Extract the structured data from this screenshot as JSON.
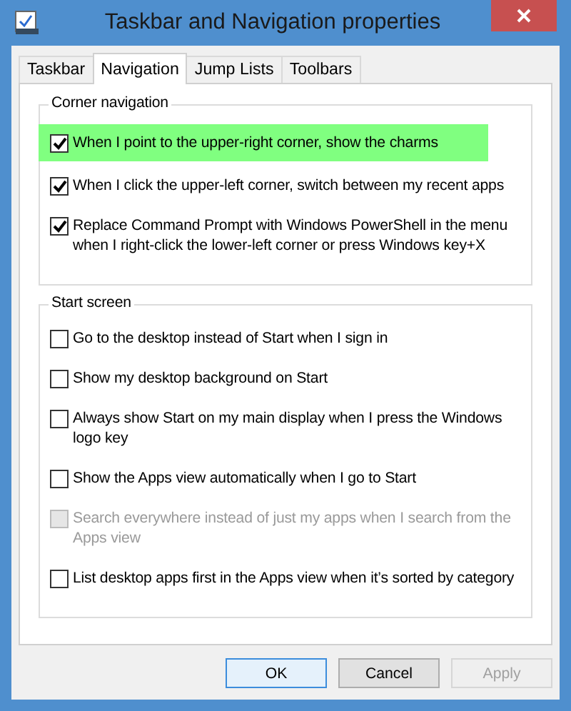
{
  "window": {
    "title": "Taskbar and Navigation properties"
  },
  "tabs": [
    {
      "label": "Taskbar",
      "selected": false
    },
    {
      "label": "Navigation",
      "selected": true
    },
    {
      "label": "Jump Lists",
      "selected": false
    },
    {
      "label": "Toolbars",
      "selected": false
    }
  ],
  "groups": [
    {
      "title": "Corner navigation",
      "options": [
        {
          "label": "When I point to the upper-right corner, show the charms",
          "checked": true,
          "disabled": false,
          "highlighted": true
        },
        {
          "label": "When I click the upper-left corner, switch between my recent apps",
          "checked": true,
          "disabled": false,
          "highlighted": false
        },
        {
          "label": "Replace Command Prompt with Windows PowerShell in the menu when I right-click the lower-left corner or press Windows key+X",
          "checked": true,
          "disabled": false,
          "highlighted": false
        }
      ]
    },
    {
      "title": "Start screen",
      "options": [
        {
          "label": "Go to the desktop instead of Start when I sign in",
          "checked": false,
          "disabled": false,
          "highlighted": false
        },
        {
          "label": "Show my desktop background on Start",
          "checked": false,
          "disabled": false,
          "highlighted": false
        },
        {
          "label": "Always show Start on my main display when I press the Windows logo key",
          "checked": false,
          "disabled": false,
          "highlighted": false
        },
        {
          "label": "Show the Apps view automatically when I go to Start",
          "checked": false,
          "disabled": false,
          "highlighted": false
        },
        {
          "label": "Search everywhere instead of just my apps when I search from the Apps view",
          "checked": false,
          "disabled": true,
          "highlighted": false
        },
        {
          "label": "List desktop apps first in the Apps view when it’s sorted by category",
          "checked": false,
          "disabled": false,
          "highlighted": false
        }
      ]
    }
  ],
  "buttons": [
    {
      "label": "OK",
      "kind": "default",
      "disabled": false
    },
    {
      "label": "Cancel",
      "kind": "normal",
      "disabled": false
    },
    {
      "label": "Apply",
      "kind": "normal",
      "disabled": true
    }
  ]
}
